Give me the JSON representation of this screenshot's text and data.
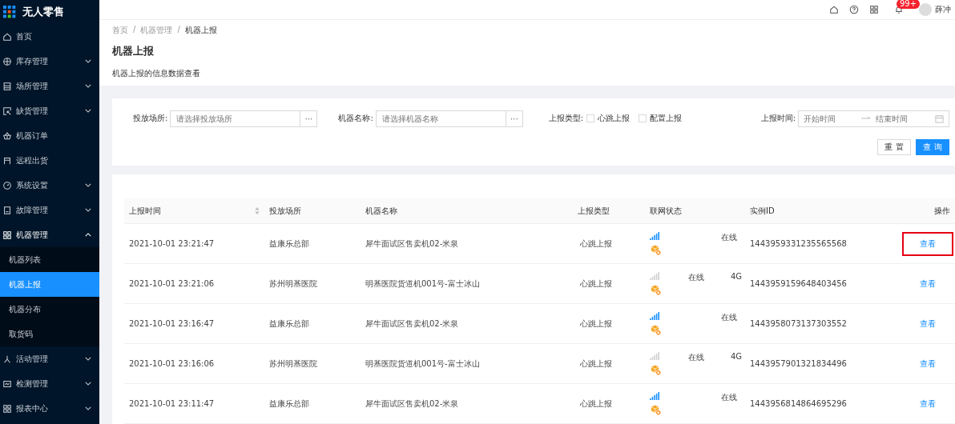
{
  "app": {
    "title": "无人零售"
  },
  "sidebar": {
    "items": [
      {
        "label": "首页",
        "kind": "link",
        "expanded": false,
        "selected": false
      },
      {
        "label": "库存管理",
        "kind": "group",
        "expanded": false,
        "selected": false
      },
      {
        "label": "场所管理",
        "kind": "group",
        "expanded": false,
        "selected": false
      },
      {
        "label": "缺货管理",
        "kind": "group",
        "expanded": false,
        "selected": false
      },
      {
        "label": "机器订单",
        "kind": "link",
        "expanded": false,
        "selected": false
      },
      {
        "label": "远程出货",
        "kind": "link",
        "expanded": false,
        "selected": false
      },
      {
        "label": "系统设置",
        "kind": "group",
        "expanded": false,
        "selected": false
      },
      {
        "label": "故障管理",
        "kind": "group",
        "expanded": false,
        "selected": false
      },
      {
        "label": "机器管理",
        "kind": "group",
        "expanded": true,
        "selected": false,
        "children": [
          {
            "label": "机器列表",
            "selected": false
          },
          {
            "label": "机器上报",
            "selected": true
          },
          {
            "label": "机器分布",
            "selected": false
          },
          {
            "label": "取货码",
            "selected": false
          }
        ]
      },
      {
        "label": "活动管理",
        "kind": "group",
        "expanded": false,
        "selected": false
      },
      {
        "label": "检测管理",
        "kind": "group",
        "expanded": false,
        "selected": false
      },
      {
        "label": "报表中心",
        "kind": "group",
        "expanded": false,
        "selected": false
      }
    ]
  },
  "header": {
    "badge": "99+",
    "user": "薛冲"
  },
  "breadcrumb": [
    {
      "label": "首页",
      "kind": "link"
    },
    {
      "label": "/",
      "kind": "separator"
    },
    {
      "label": "机器管理",
      "kind": "link"
    },
    {
      "label": "/",
      "kind": "separator"
    },
    {
      "label": "机器上报",
      "kind": "current"
    }
  ],
  "page": {
    "title": "机器上报",
    "description": "机器上报的信息数据查看"
  },
  "filters": {
    "place": {
      "label": "投放场所:",
      "placeholder": "请选择投放场所",
      "more": "···"
    },
    "machine": {
      "label": "机器名称:",
      "placeholder": "请选择机器名称",
      "more": "···"
    },
    "type": {
      "label": "上报类型:",
      "options": [
        {
          "label": "心跳上报",
          "checked": false
        },
        {
          "label": "配置上报",
          "checked": false
        }
      ]
    },
    "time": {
      "label": "上报时间:",
      "start_placeholder": "开始时间",
      "end_placeholder": "结束时间"
    },
    "buttons": [
      {
        "label": "重 置",
        "kind": "default"
      },
      {
        "label": "查 询",
        "kind": "primary"
      }
    ]
  },
  "table": {
    "columns": [
      "上报时间",
      "投放场所",
      "机器名称",
      "上报类型",
      "联网状态",
      "实例ID",
      "操作"
    ],
    "rows": [
      {
        "time": "2021-10-01 23:21:47",
        "place": "益康乐总部",
        "machine": "犀牛面试区售卖机02-米泉",
        "type": "心跳上报",
        "kind": "wifi",
        "status": "在线",
        "id": "1443959331235565568",
        "action": "查看",
        "highlighted": true
      },
      {
        "time": "2021-10-01 23:21:06",
        "place": "苏州明基医院",
        "machine": "明基医院货道机001号-富士冰山",
        "type": "心跳上报",
        "kind": "cellular",
        "status": "在线",
        "network": "4G",
        "id": "1443959159648403456",
        "action": "查看",
        "highlighted": false
      },
      {
        "time": "2021-10-01 23:16:47",
        "place": "益康乐总部",
        "machine": "犀牛面试区售卖机02-米泉",
        "type": "心跳上报",
        "kind": "wifi",
        "status": "在线",
        "id": "1443958073137303552",
        "action": "查看",
        "highlighted": false
      },
      {
        "time": "2021-10-01 23:16:06",
        "place": "苏州明基医院",
        "machine": "明基医院货道机001号-富士冰山",
        "type": "心跳上报",
        "kind": "cellular",
        "status": "在线",
        "network": "4G",
        "id": "1443957901321834496",
        "action": "查看",
        "highlighted": false
      },
      {
        "time": "2021-10-01 23:11:47",
        "place": "益康乐总部",
        "machine": "犀牛面试区售卖机02-米泉",
        "type": "心跳上报",
        "kind": "wifi",
        "status": "在线",
        "id": "1443956814864695296",
        "action": "查看",
        "highlighted": false
      }
    ]
  }
}
